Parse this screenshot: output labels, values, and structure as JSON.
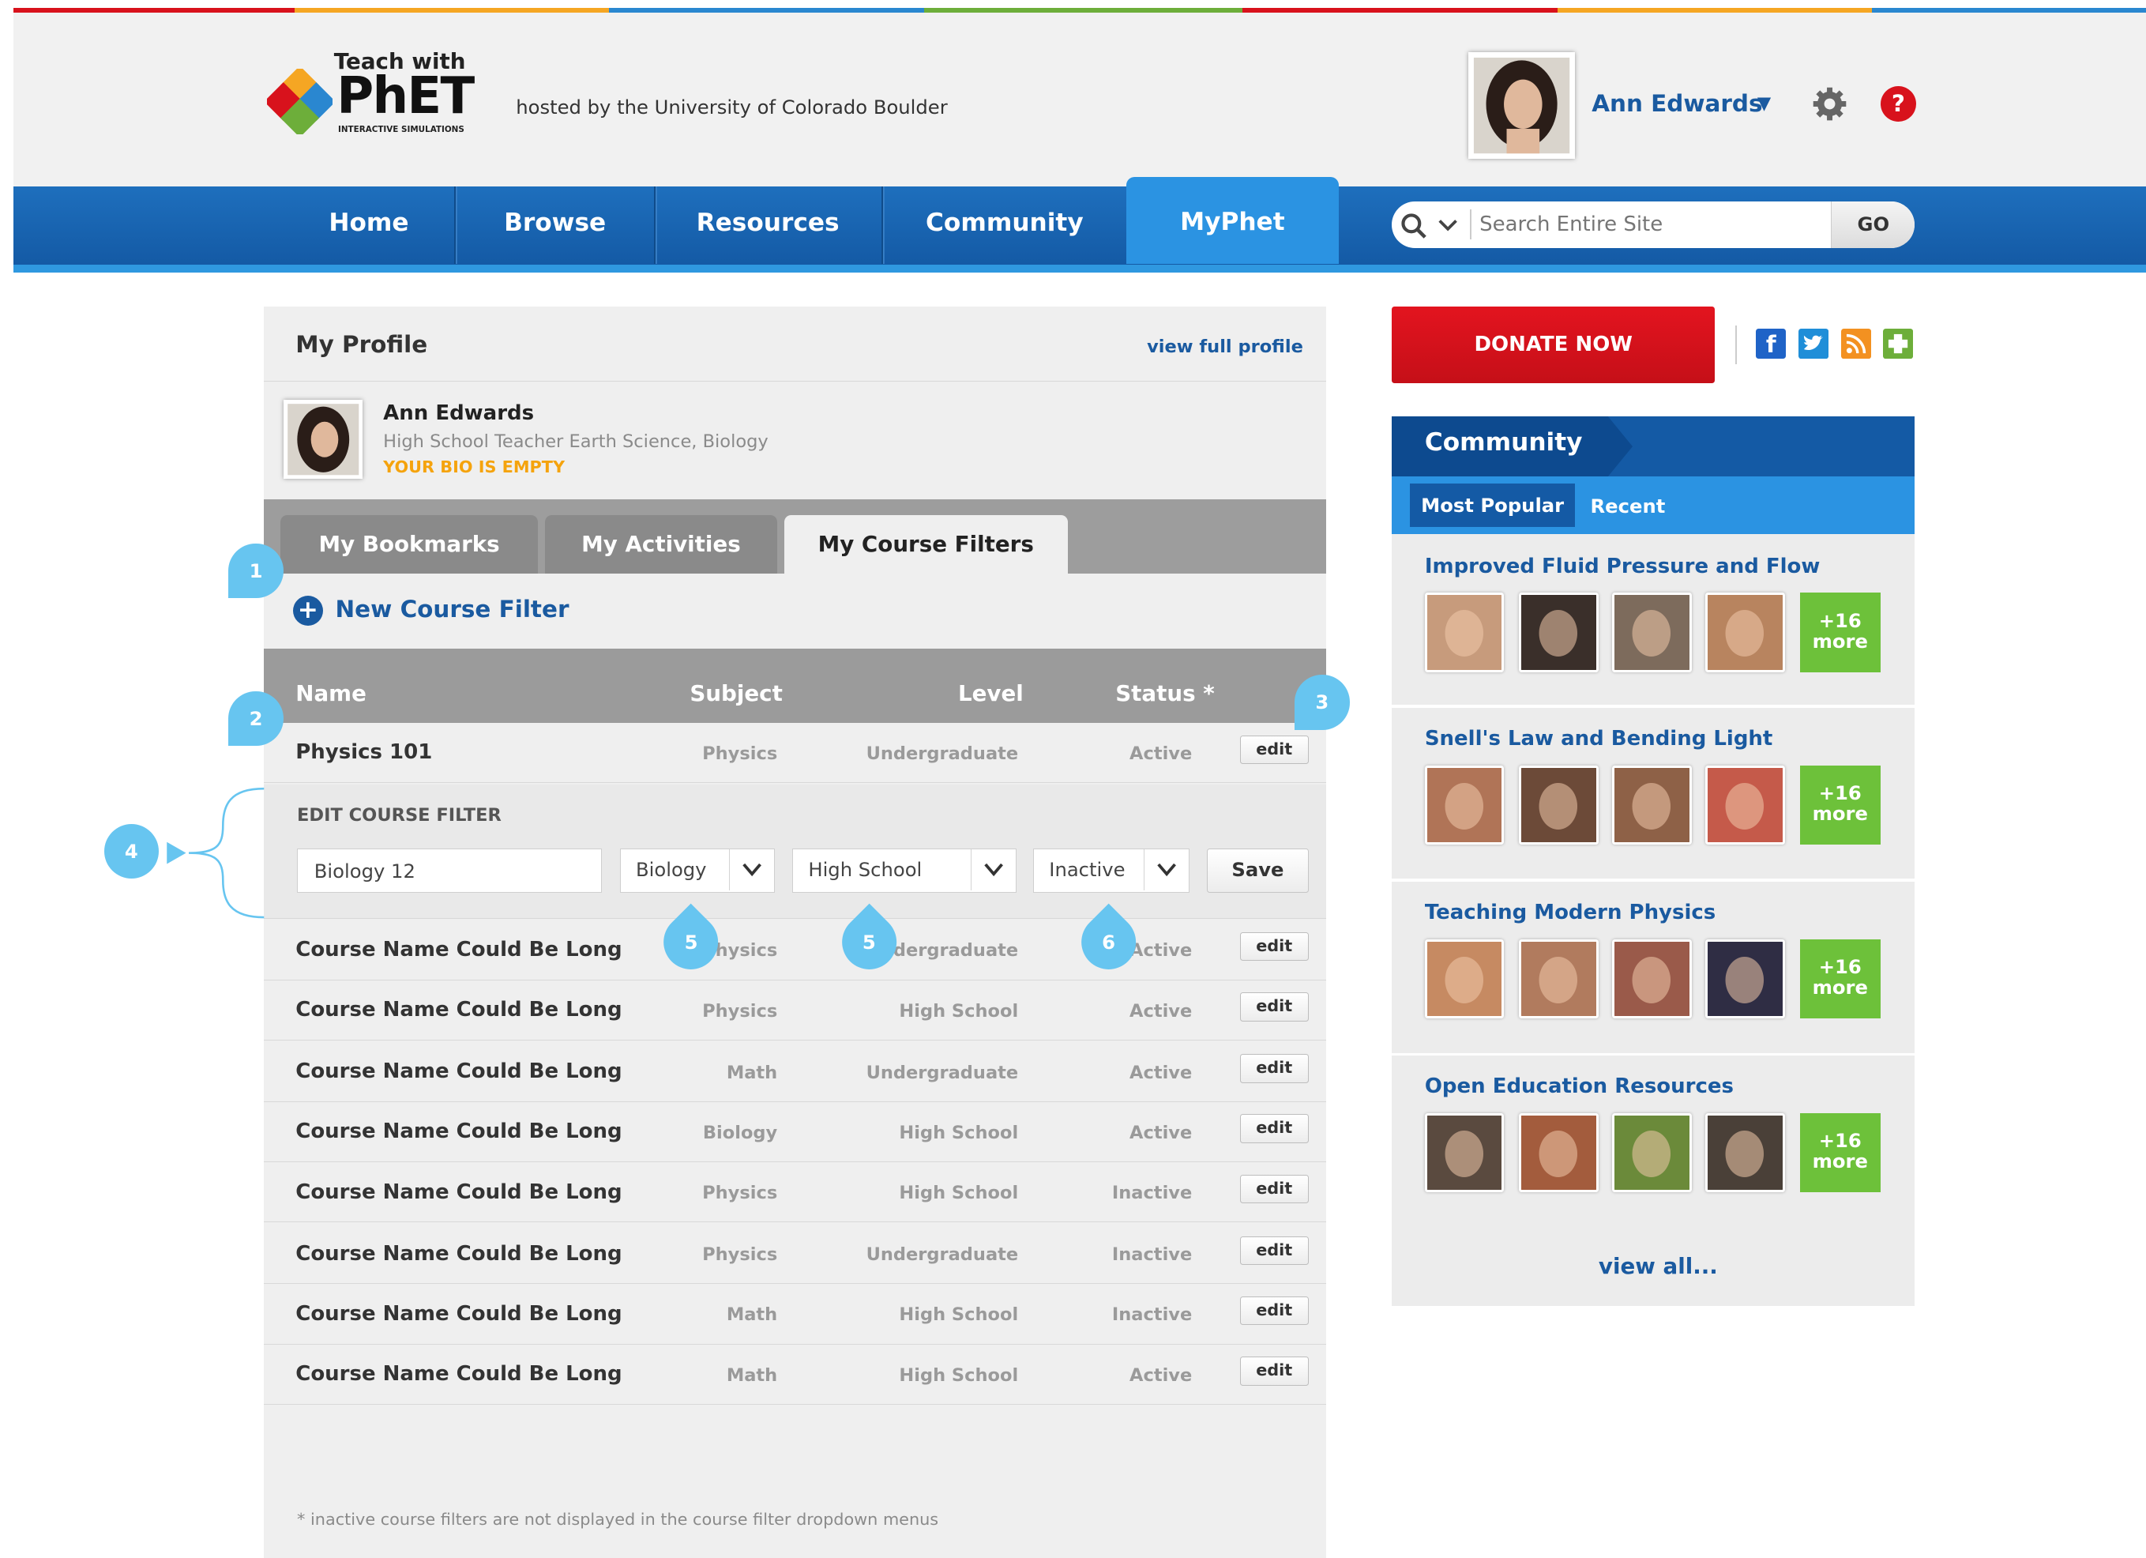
{
  "brand": {
    "teach_with": "Teach with",
    "logo_text": "PhET",
    "logo_sub": "INTERACTIVE SIMULATIONS",
    "hosted_by": "hosted by the University of Colorado Boulder"
  },
  "user": {
    "name": "Ann Edwards",
    "menu_arrow": "▼"
  },
  "nav": {
    "items": [
      "Home",
      "Browse",
      "Resources",
      "Community"
    ],
    "active": "MyPhet"
  },
  "search": {
    "placeholder": "Search Entire Site",
    "go": "GO"
  },
  "profile": {
    "title": "My Profile",
    "view_full": "view full profile",
    "name": "Ann Edwards",
    "desc": "High School Teacher Earth Science, Biology",
    "bio_empty": "YOUR BIO IS EMPTY"
  },
  "tabs": {
    "bookmarks": "My Bookmarks",
    "activities": "My Activities",
    "course_filters": "My Course Filters"
  },
  "new_filter": "New Course Filter",
  "table": {
    "headers": {
      "name": "Name",
      "subject": "Subject",
      "level": "Level",
      "status": "Status *"
    },
    "first_row": {
      "name": "Physics 101",
      "subject": "Physics",
      "level": "Undergraduate",
      "status": "Active",
      "edit": "edit"
    },
    "rows": [
      {
        "name": "Course Name Could Be Long",
        "subject": "Physics",
        "level": "Undergraduate",
        "status": "Active",
        "edit": "edit"
      },
      {
        "name": "Course Name Could Be Long",
        "subject": "Physics",
        "level": "High School",
        "status": "Active",
        "edit": "edit"
      },
      {
        "name": "Course Name Could Be Long",
        "subject": "Math",
        "level": "Undergraduate",
        "status": "Active",
        "edit": "edit"
      },
      {
        "name": "Course Name Could Be Long",
        "subject": "Biology",
        "level": "High School",
        "status": "Active",
        "edit": "edit"
      },
      {
        "name": "Course Name Could Be Long",
        "subject": "Physics",
        "level": "High School",
        "status": "Inactive",
        "edit": "edit"
      },
      {
        "name": "Course Name Could Be Long",
        "subject": "Physics",
        "level": "Undergraduate",
        "status": "Inactive",
        "edit": "edit"
      },
      {
        "name": "Course Name Could Be Long",
        "subject": "Math",
        "level": "High School",
        "status": "Inactive",
        "edit": "edit"
      },
      {
        "name": "Course Name Could Be Long",
        "subject": "Math",
        "level": "High School",
        "status": "Active",
        "edit": "edit"
      }
    ]
  },
  "edit_panel": {
    "title": "EDIT COURSE FILTER",
    "name_value": "Biology 12",
    "subject": "Biology",
    "level": "High School",
    "status": "Inactive",
    "save": "Save"
  },
  "footnote": "* inactive course filters are not displayed in the course filter dropdown menus",
  "annotations": [
    "1",
    "2",
    "3",
    "4",
    "5",
    "5",
    "6"
  ],
  "donate": "DONATE NOW",
  "community": {
    "title": "Community",
    "tab_popular": "Most Popular",
    "tab_recent": "Recent",
    "topics": [
      {
        "title": "Improved Fluid Pressure and Flow",
        "more": "+16",
        "more2": "more"
      },
      {
        "title": "Snell's Law and Bending Light",
        "more": "+16",
        "more2": "more"
      },
      {
        "title": "Teaching Modern Physics",
        "more": "+16",
        "more2": "more"
      },
      {
        "title": "Open Education Resources",
        "more": "+16",
        "more2": "more"
      }
    ],
    "view_all": "view all..."
  },
  "colors": {
    "brand_blue": "#145aa5",
    "accent": "#2b93e2",
    "donate_red": "#d8121c",
    "more_green": "#6dc13a",
    "bio_orange": "#f5a30d"
  }
}
